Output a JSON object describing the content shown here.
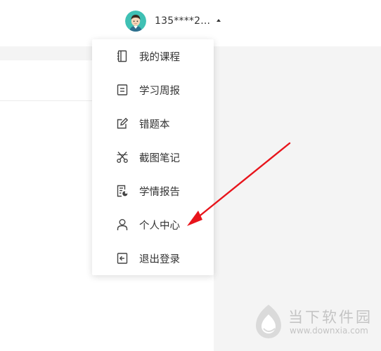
{
  "header": {
    "phone": "135****2...",
    "avatar": "user-avatar"
  },
  "menu": {
    "items": [
      {
        "label": "我的课程",
        "icon": "notebook-icon"
      },
      {
        "label": "学习周报",
        "icon": "report-icon"
      },
      {
        "label": "错题本",
        "icon": "edit-icon"
      },
      {
        "label": "截图笔记",
        "icon": "scissors-icon"
      },
      {
        "label": "学情报告",
        "icon": "analysis-icon"
      },
      {
        "label": "个人中心",
        "icon": "user-icon"
      },
      {
        "label": "退出登录",
        "icon": "logout-icon"
      }
    ]
  },
  "watermark": {
    "title": "当下软件园",
    "url": "www.downxia.com"
  },
  "colors": {
    "annotation": "#e8141b",
    "text": "#333333",
    "watermark": "#c4c4c4"
  }
}
